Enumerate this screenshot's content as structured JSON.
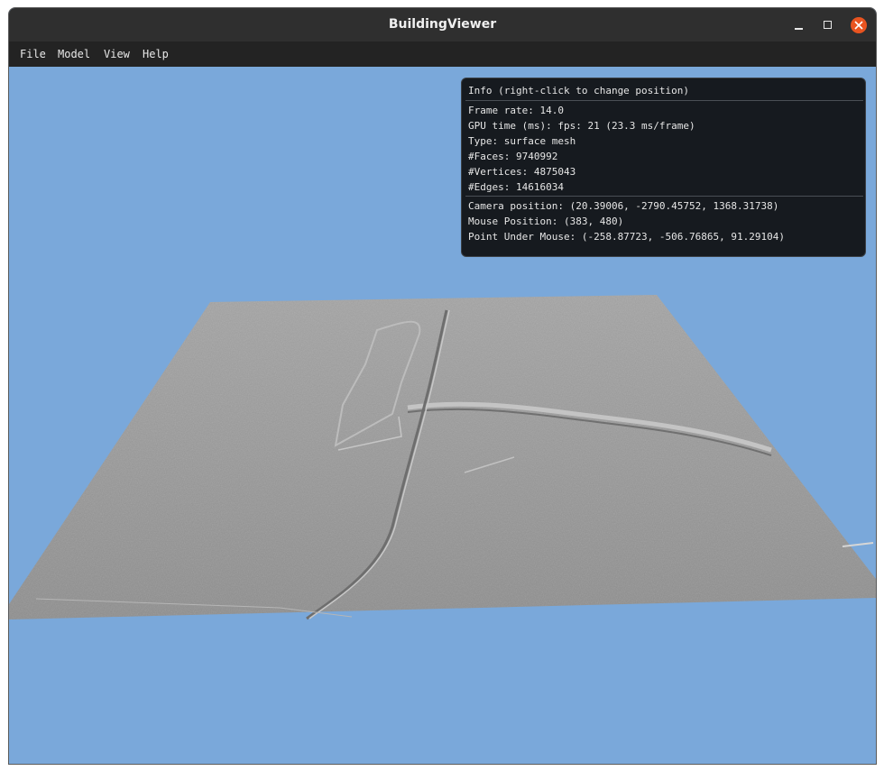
{
  "window": {
    "title": "BuildingViewer"
  },
  "menu": [
    "File",
    "Model",
    "View",
    "Help"
  ],
  "info_panel": {
    "header": "Info (right-click to change position)",
    "frame_rate": "Frame rate: 14.0",
    "gpu_time": "GPU time (ms): fps: 21 (23.3 ms/frame)",
    "type": "Type: surface mesh",
    "faces": "#Faces: 9740992",
    "vertices": "#Vertices: 4875043",
    "edges": "#Edges: 14616034",
    "camera_position": "Camera position: (20.39006, -2790.45752, 1368.31738)",
    "mouse_position": "Mouse Position: (383, 480)",
    "point_under_mouse": "Point Under Mouse: (-258.87723, -506.76865, 91.29104)"
  },
  "colors": {
    "background": "#7aa8da",
    "terrain": "#9a9a9a",
    "titlebar": "#2f2f2f",
    "menubar": "#232323",
    "close_button": "#e95420",
    "panel": "#161a1f"
  }
}
